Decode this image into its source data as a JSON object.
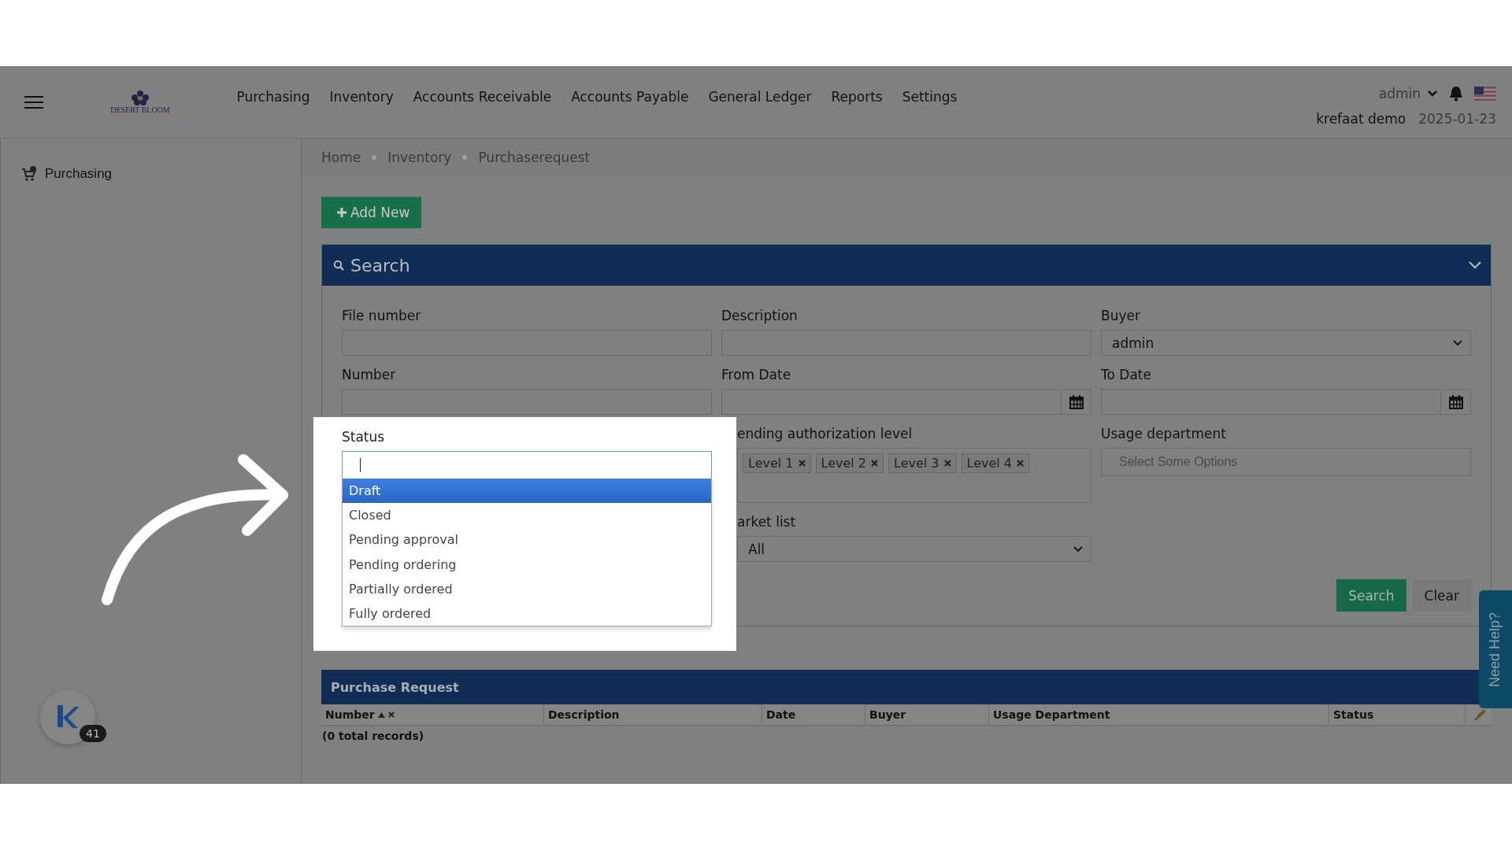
{
  "header": {
    "brand": "DESERT BLOOM",
    "nav": [
      "Purchasing",
      "Inventory",
      "Accounts Receivable",
      "Accounts Payable",
      "General Ledger",
      "Reports",
      "Settings"
    ],
    "user": "admin",
    "account": "krefaat demo",
    "date": "2025-01-23"
  },
  "sidebar": {
    "items": [
      {
        "label": "Purchasing"
      }
    ]
  },
  "breadcrumb": [
    "Home",
    "Inventory",
    "Purchaserequest"
  ],
  "add_button": "Add New",
  "search_panel": {
    "title": "Search",
    "fields": [
      {
        "kind": "text",
        "label": "File number"
      },
      {
        "kind": "text",
        "label": "Description"
      },
      {
        "kind": "select",
        "label": "Buyer",
        "value": "admin"
      },
      {
        "kind": "text",
        "label": "Number"
      },
      {
        "kind": "date",
        "label": "From Date"
      },
      {
        "kind": "date",
        "label": "To Date"
      },
      {
        "kind": "combo",
        "label": "Status",
        "options": [
          {
            "label": "Draft",
            "selected": true
          },
          {
            "label": "Closed",
            "selected": false
          },
          {
            "label": "Pending approval",
            "selected": false
          },
          {
            "label": "Pending ordering",
            "selected": false
          },
          {
            "label": "Partially ordered",
            "selected": false
          },
          {
            "label": "Fully ordered",
            "selected": false
          }
        ]
      },
      {
        "kind": "tags",
        "label": "ending authorization level",
        "tags": [
          "Level 1",
          "Level 2",
          "Level 3",
          "Level 4"
        ]
      },
      {
        "kind": "multi",
        "label": "Usage department",
        "placeholder": "Select Some Options"
      },
      {
        "kind": "select",
        "label": "arket list",
        "value": "All"
      }
    ],
    "buttons": [
      {
        "label": "Search",
        "kind": "primary"
      },
      {
        "label": "Clear",
        "kind": "plain"
      }
    ]
  },
  "table": {
    "title": "Purchase Request",
    "columns": [
      "Number",
      "Description",
      "Date",
      "Buyer",
      "Usage Department",
      "Status"
    ],
    "footer": "(0 total records)"
  },
  "help_tab": "Need Help?",
  "avatar": {
    "badge": "41"
  }
}
